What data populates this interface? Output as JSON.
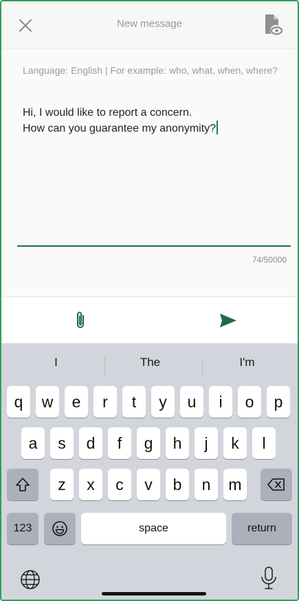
{
  "header": {
    "title": "New message"
  },
  "compose": {
    "hint": "Language: English | For example: who, what, when, where?",
    "message": "Hi, I would like to report a concern.\nHow can you guarantee my anonymity?",
    "counter": "74/50000"
  },
  "colors": {
    "accent": "#1f6d43",
    "frame": "#2e9e5b",
    "keyboard_bg": "#d2d5db"
  },
  "icons": {
    "close": "close-icon",
    "preview": "document-eye-icon",
    "attach": "paperclip-icon",
    "send": "send-icon",
    "shift": "shift-icon",
    "backspace": "backspace-icon",
    "emoji": "emoji-icon",
    "globe": "globe-icon",
    "mic": "microphone-icon"
  },
  "keyboard": {
    "suggestions": [
      "I",
      "The",
      "I'm"
    ],
    "row1": [
      "q",
      "w",
      "e",
      "r",
      "t",
      "y",
      "u",
      "i",
      "o",
      "p"
    ],
    "row2": [
      "a",
      "s",
      "d",
      "f",
      "g",
      "h",
      "j",
      "k",
      "l"
    ],
    "row3": [
      "z",
      "x",
      "c",
      "v",
      "b",
      "n",
      "m"
    ],
    "numbers_label": "123",
    "space_label": "space",
    "return_label": "return"
  }
}
